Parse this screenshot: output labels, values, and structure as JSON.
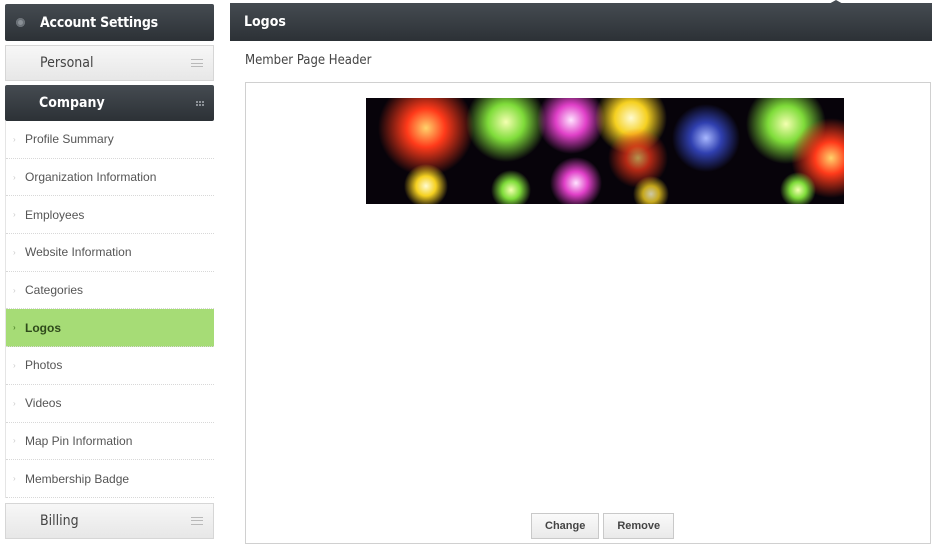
{
  "sidebar": {
    "title": "Account Settings",
    "sections": {
      "personal": "Personal",
      "company": "Company",
      "billing": "Billing"
    },
    "items": [
      {
        "label": "Profile Summary",
        "active": false
      },
      {
        "label": "Organization Information",
        "active": false
      },
      {
        "label": "Employees",
        "active": false
      },
      {
        "label": "Website Information",
        "active": false
      },
      {
        "label": "Categories",
        "active": false
      },
      {
        "label": "Logos",
        "active": true
      },
      {
        "label": "Photos",
        "active": false
      },
      {
        "label": "Videos",
        "active": false
      },
      {
        "label": "Map Pin Information",
        "active": false
      },
      {
        "label": "Membership Badge",
        "active": false
      }
    ]
  },
  "main": {
    "title": "Logos",
    "section_label": "Member Page Header",
    "buttons": {
      "change": "Change",
      "remove": "Remove"
    }
  },
  "colors": {
    "header_dark": "#2c3136",
    "active_item": "#a6dc76"
  }
}
